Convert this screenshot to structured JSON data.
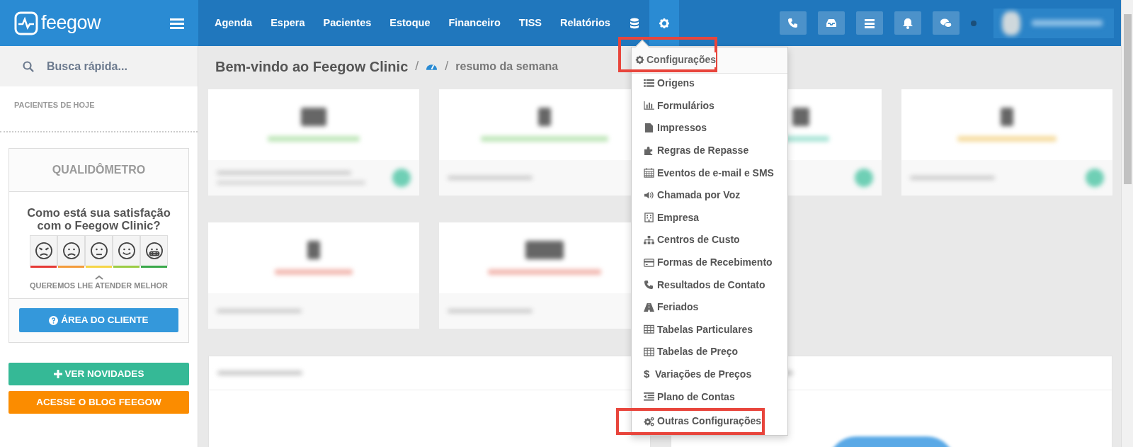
{
  "brand": {
    "name": "feegow"
  },
  "nav": {
    "links": [
      {
        "label": "Agenda",
        "selected": false
      },
      {
        "label": "Espera",
        "selected": false
      },
      {
        "label": "Pacientes",
        "selected": false
      },
      {
        "label": "Estoque",
        "selected": false
      },
      {
        "label": "Financeiro",
        "selected": false
      },
      {
        "label": "TISS",
        "selected": false
      },
      {
        "label": "Relatórios",
        "selected": false
      }
    ],
    "icon_items": [
      {
        "kind": "database",
        "selected": false
      },
      {
        "kind": "settings",
        "selected": true
      }
    ]
  },
  "sidebar": {
    "search": {
      "placeholder": "Busca rápida..."
    },
    "section_title": "PACIENTES DE HOJE",
    "survey": {
      "title": "QUALIDÔMETRO",
      "question": "Como está sua satisfação com o Feegow Clinic?",
      "options": [
        {
          "kind": "angry",
          "color": "#e53935"
        },
        {
          "kind": "sad",
          "color": "#f39c3c"
        },
        {
          "kind": "neutral",
          "color": "#f5d547"
        },
        {
          "kind": "happy",
          "color": "#9ccc45"
        },
        {
          "kind": "grin",
          "color": "#3aa84a"
        }
      ],
      "caption": "QUEREMOS LHE ATENDER MELHOR",
      "button": "ÁREA DO CLIENTE"
    },
    "buttons": [
      {
        "label": "VER NOVIDADES",
        "kind": "news"
      },
      {
        "label": "ACESSE O BLOG FEEGOW",
        "kind": "blog"
      }
    ]
  },
  "breadcrumb": {
    "title": "Bem-vindo ao Feegow Clinic",
    "separator_1": "/",
    "separator_2": "/",
    "current": "resumo da semana"
  },
  "settings_menu": {
    "header": {
      "label": "Configurações",
      "highlighted": true
    },
    "items": [
      {
        "label": "Origens",
        "highlighted": false
      },
      {
        "label": "Formulários",
        "highlighted": false
      },
      {
        "label": "Impressos",
        "highlighted": false
      },
      {
        "label": "Regras de Repasse",
        "highlighted": false
      },
      {
        "label": "Eventos de e-mail e SMS",
        "highlighted": false
      },
      {
        "label": "Chamada por Voz",
        "highlighted": false
      },
      {
        "label": "Empresa",
        "highlighted": false
      },
      {
        "label": "Centros de Custo",
        "highlighted": false
      },
      {
        "label": "Formas de Recebimento",
        "highlighted": false
      },
      {
        "label": "Resultados de Contato",
        "highlighted": false
      },
      {
        "label": "Feriados",
        "highlighted": false
      },
      {
        "label": "Tabelas Particulares",
        "highlighted": false
      },
      {
        "label": "Tabelas de Preço",
        "highlighted": false
      },
      {
        "label": "Variações de Preços",
        "highlighted": false,
        "symbol": "$"
      },
      {
        "label": "Plano de Contas",
        "highlighted": false
      },
      {
        "label": "Outras Configurações",
        "highlighted": true
      }
    ]
  }
}
